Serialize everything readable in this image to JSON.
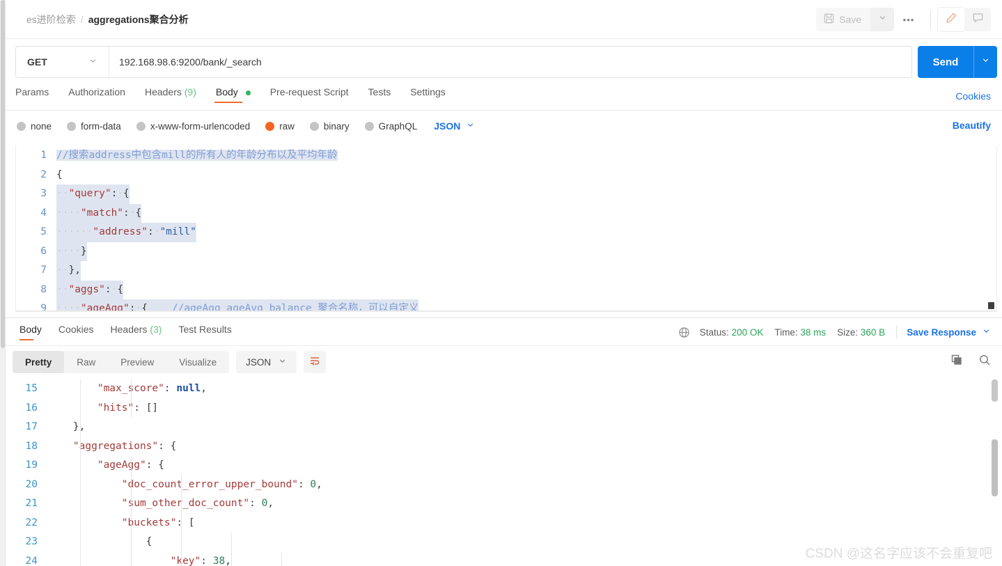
{
  "header": {
    "breadcrumb_parent": "es进阶检索",
    "breadcrumb_sep": "/",
    "breadcrumb_current": "aggregations聚合分析",
    "save_label": "Save",
    "more_label": "•••"
  },
  "request": {
    "method": "GET",
    "url": "192.168.98.6:9200/bank/_search",
    "send_label": "Send",
    "tabs": [
      {
        "label": "Params",
        "count": "",
        "active": false
      },
      {
        "label": "Authorization",
        "count": "",
        "active": false
      },
      {
        "label": "Headers",
        "count": "(9)",
        "active": false
      },
      {
        "label": "Body",
        "count": "",
        "active": true
      },
      {
        "label": "Pre-request Script",
        "count": "",
        "active": false
      },
      {
        "label": "Tests",
        "count": "",
        "active": false
      },
      {
        "label": "Settings",
        "count": "",
        "active": false
      }
    ],
    "cookies_link": "Cookies",
    "beautify_link": "Beautify",
    "body_types": [
      {
        "label": "none",
        "selected": false
      },
      {
        "label": "form-data",
        "selected": false
      },
      {
        "label": "x-www-form-urlencoded",
        "selected": false
      },
      {
        "label": "raw",
        "selected": true
      },
      {
        "label": "binary",
        "selected": false
      },
      {
        "label": "GraphQL",
        "selected": false
      }
    ],
    "raw_format": "JSON",
    "code_lines": [
      {
        "n": "1",
        "text": "//搜索address中包含mill的所有人的年龄分布以及平均年龄"
      },
      {
        "n": "2",
        "text": "{"
      },
      {
        "n": "3",
        "text": "  \"query\": {"
      },
      {
        "n": "4",
        "text": "    \"match\": {"
      },
      {
        "n": "5",
        "text": "      \"address\": \"mill\""
      },
      {
        "n": "6",
        "text": "    }"
      },
      {
        "n": "7",
        "text": "  },"
      },
      {
        "n": "8",
        "text": "  \"aggs\": {"
      },
      {
        "n": "9",
        "text": "    \"ageAgg\": {    //ageAgg ageAvg balance 聚合名称，可以自定义"
      }
    ]
  },
  "response": {
    "tabs": [
      {
        "label": "Body",
        "count": "",
        "active": true
      },
      {
        "label": "Cookies",
        "count": "",
        "active": false
      },
      {
        "label": "Headers",
        "count": "(3)",
        "active": false
      },
      {
        "label": "Test Results",
        "count": "",
        "active": false
      }
    ],
    "status_label": "Status:",
    "status_value": "200 OK",
    "time_label": "Time:",
    "time_value": "38 ms",
    "size_label": "Size:",
    "size_value": "360 B",
    "save_response": "Save Response",
    "view_modes": [
      {
        "label": "Pretty",
        "active": true
      },
      {
        "label": "Raw",
        "active": false
      },
      {
        "label": "Preview",
        "active": false
      },
      {
        "label": "Visualize",
        "active": false
      }
    ],
    "format": "JSON",
    "code_lines": [
      {
        "n": "15",
        "text": "        \"max_score\": null,"
      },
      {
        "n": "16",
        "text": "        \"hits\": []"
      },
      {
        "n": "17",
        "text": "    },"
      },
      {
        "n": "18",
        "text": "    \"aggregations\": {"
      },
      {
        "n": "19",
        "text": "        \"ageAgg\": {"
      },
      {
        "n": "20",
        "text": "            \"doc_count_error_upper_bound\": 0,"
      },
      {
        "n": "21",
        "text": "            \"sum_other_doc_count\": 0,"
      },
      {
        "n": "22",
        "text": "            \"buckets\": ["
      },
      {
        "n": "23",
        "text": "                {"
      },
      {
        "n": "24",
        "text": "                    \"key\": 38,"
      }
    ]
  },
  "watermark": "CSDN @这名字应该不会重复吧",
  "colors": {
    "accent_orange": "#ef6c2e",
    "link_blue": "#1a73e8",
    "send_blue": "#0b7fe8",
    "status_green": "#2aa35a",
    "radio_on": "#f26522"
  }
}
